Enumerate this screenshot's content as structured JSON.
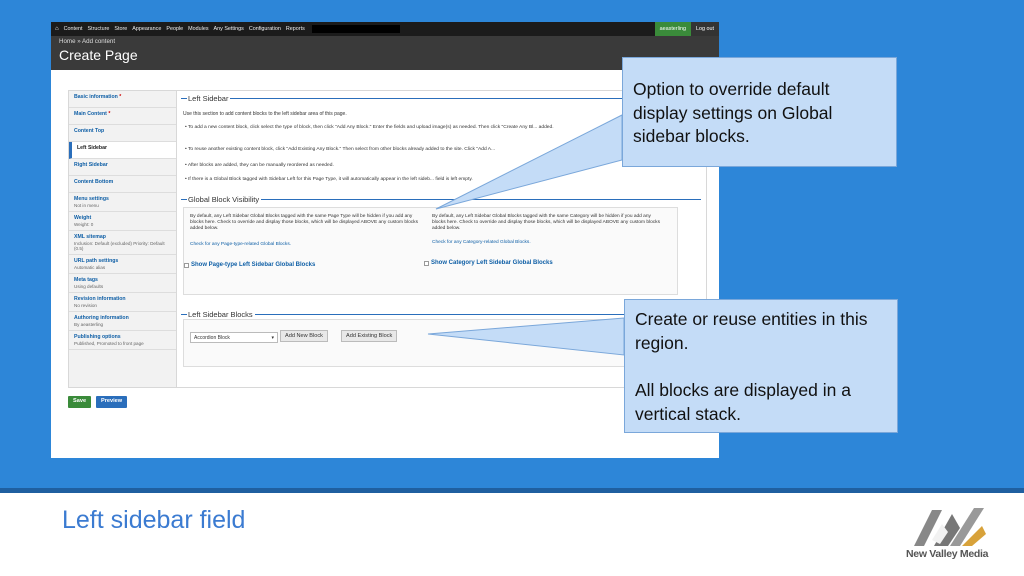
{
  "slide": {
    "title": "Left sidebar field",
    "logo_text": "New Valley Media"
  },
  "adminbar": {
    "home_icon": "home-icon",
    "menu": [
      "Content",
      "Structure",
      "Store",
      "Appearance",
      "People",
      "Modules",
      "Any Settings",
      "Configuration",
      "Reports"
    ],
    "user": "aeasterling",
    "logout": "Log out"
  },
  "header": {
    "breadcrumb": "Home » Add content",
    "title": "Create Page"
  },
  "vtabs": [
    {
      "label": "Basic information",
      "required": true,
      "sub": ""
    },
    {
      "label": "Main Content",
      "required": true,
      "sub": ""
    },
    {
      "label": "Content Top",
      "required": false,
      "sub": ""
    },
    {
      "label": "Left Sidebar",
      "required": false,
      "sub": "",
      "active": true
    },
    {
      "label": "Right Sidebar",
      "required": false,
      "sub": ""
    },
    {
      "label": "Content Bottom",
      "required": false,
      "sub": ""
    },
    {
      "label": "Menu settings",
      "required": false,
      "sub": "Not in menu"
    },
    {
      "label": "Weight",
      "required": false,
      "sub": "Weight: 0"
    },
    {
      "label": "XML sitemap",
      "required": false,
      "sub": "Inclusion: Default (excluded) Priority: Default (0.5)"
    },
    {
      "label": "URL path settings",
      "required": false,
      "sub": "Automatic alias"
    },
    {
      "label": "Meta tags",
      "required": false,
      "sub": "Using defaults"
    },
    {
      "label": "Revision information",
      "required": false,
      "sub": "No revision"
    },
    {
      "label": "Authoring information",
      "required": false,
      "sub": "By aeasterling"
    },
    {
      "label": "Publishing options",
      "required": false,
      "sub": "Published, Promoted to front page"
    }
  ],
  "left_sidebar": {
    "legend": "Left Sidebar",
    "description": "Use this section to add content blocks to the left sidebar area of this page.",
    "bullets": [
      "To add a new content block, click select the type of block, then click \"Add Any Block.\" Enter the fields and upload image(s) as needed. Then click \"Create Any Bl... added.",
      "To reuse another existing content block, click \"Add Existing Any Block.\" Then select from other blocks already added to the site. Click \"Add A...",
      "After blocks are added, they can be manually reordered as needed.",
      "If there is a Global Block tagged with Sidebar Left for this Page Type, it will automatically appear in the left sideb... field is left empty."
    ]
  },
  "global_block_visibility": {
    "legend": "Global Block Visibility",
    "left_text": "By default, any Left Sidebar Global Blocks tagged with the same Page Type will be hidden if you add any blocks here. Check to override and display those blocks, which will be displayed ABOVE any custom blocks added below.",
    "left_link": "Check for any Page-type-related Global Blocks.",
    "left_checkbox": "Show Page-type Left Sidebar Global Blocks",
    "right_text": "By default, any Left Sidebar Global Blocks tagged with the same Category will be hidden if you add any blocks here. Check to override and display those blocks, which will be displayed ABOVE any custom blocks added below.",
    "right_link": "Check for any Category-related Global Blocks.",
    "right_checkbox": "Show Category Left Sidebar Global Blocks"
  },
  "left_sidebar_blocks": {
    "legend": "Left Sidebar Blocks",
    "select_value": "Accordion Block",
    "add_new": "Add New Block",
    "add_existing": "Add Existing Block"
  },
  "actions": {
    "save": "Save",
    "preview": "Preview"
  },
  "callouts": {
    "first": "Option to override default display settings on Global sidebar blocks.",
    "second_a": "Create or reuse entities in this region.",
    "second_b": "All blocks are displayed in a vertical stack."
  },
  "colors": {
    "slide_blue": "#2d86d8",
    "callout_fill": "#c4dcf7",
    "admin_green": "#3a8b3a",
    "link_blue": "#0f5fa6"
  }
}
